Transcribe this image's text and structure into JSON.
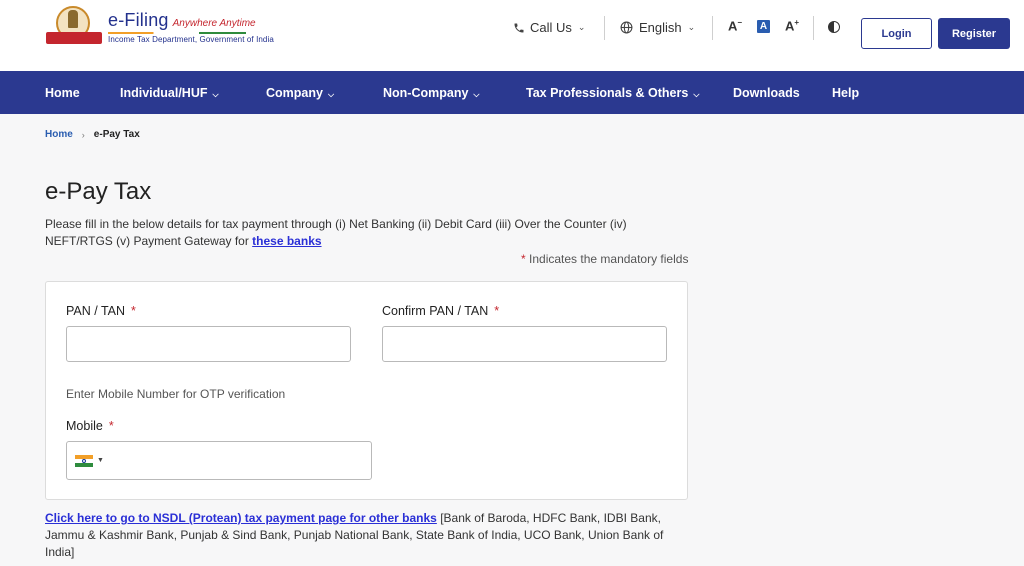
{
  "header": {
    "logo_title": "e-Filing",
    "logo_tagline": "Anywhere Anytime",
    "logo_subtitle": "Income Tax Department, Government of India",
    "call_us": "Call Us",
    "language": "English",
    "font_decrease": "A",
    "font_normal": "A",
    "font_increase": "A",
    "login": "Login",
    "register": "Register"
  },
  "nav": {
    "items": [
      {
        "label": "Home",
        "dropdown": false
      },
      {
        "label": "Individual/HUF",
        "dropdown": true
      },
      {
        "label": "Company",
        "dropdown": true
      },
      {
        "label": "Non-Company",
        "dropdown": true
      },
      {
        "label": "Tax Professionals & Others",
        "dropdown": true
      },
      {
        "label": "Downloads",
        "dropdown": false
      },
      {
        "label": "Help",
        "dropdown": false
      }
    ]
  },
  "breadcrumb": {
    "home": "Home",
    "current": "e-Pay Tax"
  },
  "page": {
    "title": "e-Pay Tax",
    "intro_text": "Please fill in the below details for tax payment through (i) Net Banking (ii) Debit Card (iii) Over the Counter (iv) NEFT/RTGS (v) Payment Gateway for ",
    "intro_link": "these banks",
    "mandatory_star": "*",
    "mandatory_note": "Indicates the mandatory fields"
  },
  "form": {
    "pan_label": "PAN / TAN",
    "pan_value": "",
    "confirm_pan_label": "Confirm PAN / TAN",
    "confirm_pan_value": "",
    "otp_hint": "Enter Mobile Number for OTP verification",
    "mobile_label": "Mobile",
    "mobile_value": "",
    "required_star": "*"
  },
  "footer_note": {
    "link": "Click here to go to NSDL (Protean) tax payment page for other banks",
    "text": " [Bank of Baroda, HDFC Bank, IDBI Bank, Jammu & Kashmir Bank, Punjab & Sind Bank, Punjab National Bank, State Bank of India, UCO Bank, Union Bank of India]"
  },
  "colors": {
    "primary": "#2b3990",
    "link": "#2a2fd6",
    "required": "#c4262e"
  }
}
